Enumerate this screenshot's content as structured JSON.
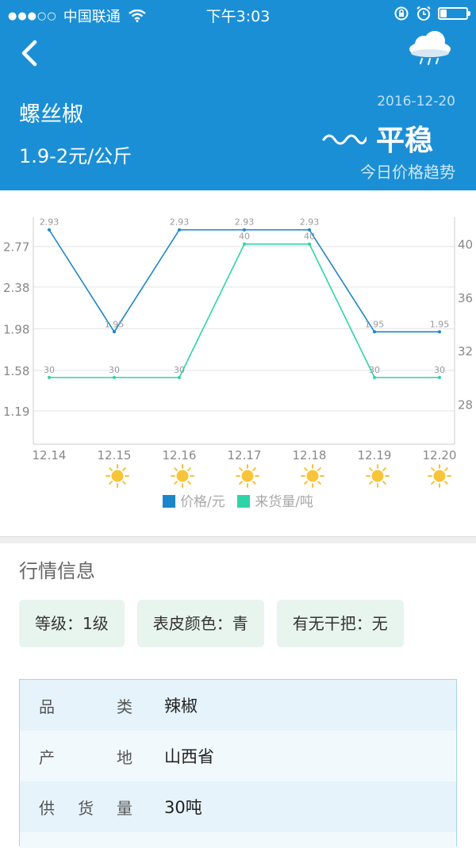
{
  "status_bar": {
    "carrier": "中国联通",
    "time": "下午3:03",
    "battery_level": 0.25
  },
  "header": {
    "product_name": "螺丝椒",
    "price_range": "1.9-2元/公斤",
    "date": "2016-12-20",
    "trend": "平稳",
    "trend_caption": "今日价格趋势",
    "weather_icon": "cloud-rain-icon",
    "back_icon": "chevron-left-icon"
  },
  "chart_data": {
    "type": "line",
    "categories": [
      "12.14",
      "12.15",
      "12.16",
      "12.17",
      "12.18",
      "12.19",
      "12.20"
    ],
    "series": [
      {
        "name": "价格/元",
        "values": [
          2.93,
          1.95,
          2.93,
          2.93,
          2.93,
          1.95,
          1.95
        ],
        "color": "#1b86c9",
        "axis": "left"
      },
      {
        "name": "来货量/吨",
        "values": [
          30,
          30,
          30,
          40,
          40,
          30,
          30
        ],
        "color": "#2ed4a6",
        "axis": "right"
      }
    ],
    "left_ticks": [
      "2.77",
      "2.38",
      "1.98",
      "1.58",
      "1.19"
    ],
    "left_tick_values": [
      2.77,
      2.38,
      1.98,
      1.58,
      1.19
    ],
    "right_ticks": [
      "40",
      "36",
      "32",
      "28"
    ],
    "right_tick_values": [
      40,
      36,
      32,
      28
    ],
    "left_range": [
      0.87,
      3.05
    ],
    "right_range": [
      25,
      42
    ],
    "weather_per_day": [
      "sun-icon",
      "sun-icon",
      "sun-icon",
      "sun-icon",
      "sun-icon",
      "sun-icon"
    ],
    "grid": true,
    "legend_position": "bottom"
  },
  "market": {
    "title": "行情信息",
    "tags": [
      "等级：1级",
      "表皮颜色：青",
      "有无干把：无"
    ],
    "rows": [
      {
        "key": "品类",
        "value": "辣椒"
      },
      {
        "key": "产地",
        "value": "山西省"
      },
      {
        "key": "供货量",
        "value": "30吨"
      }
    ]
  }
}
